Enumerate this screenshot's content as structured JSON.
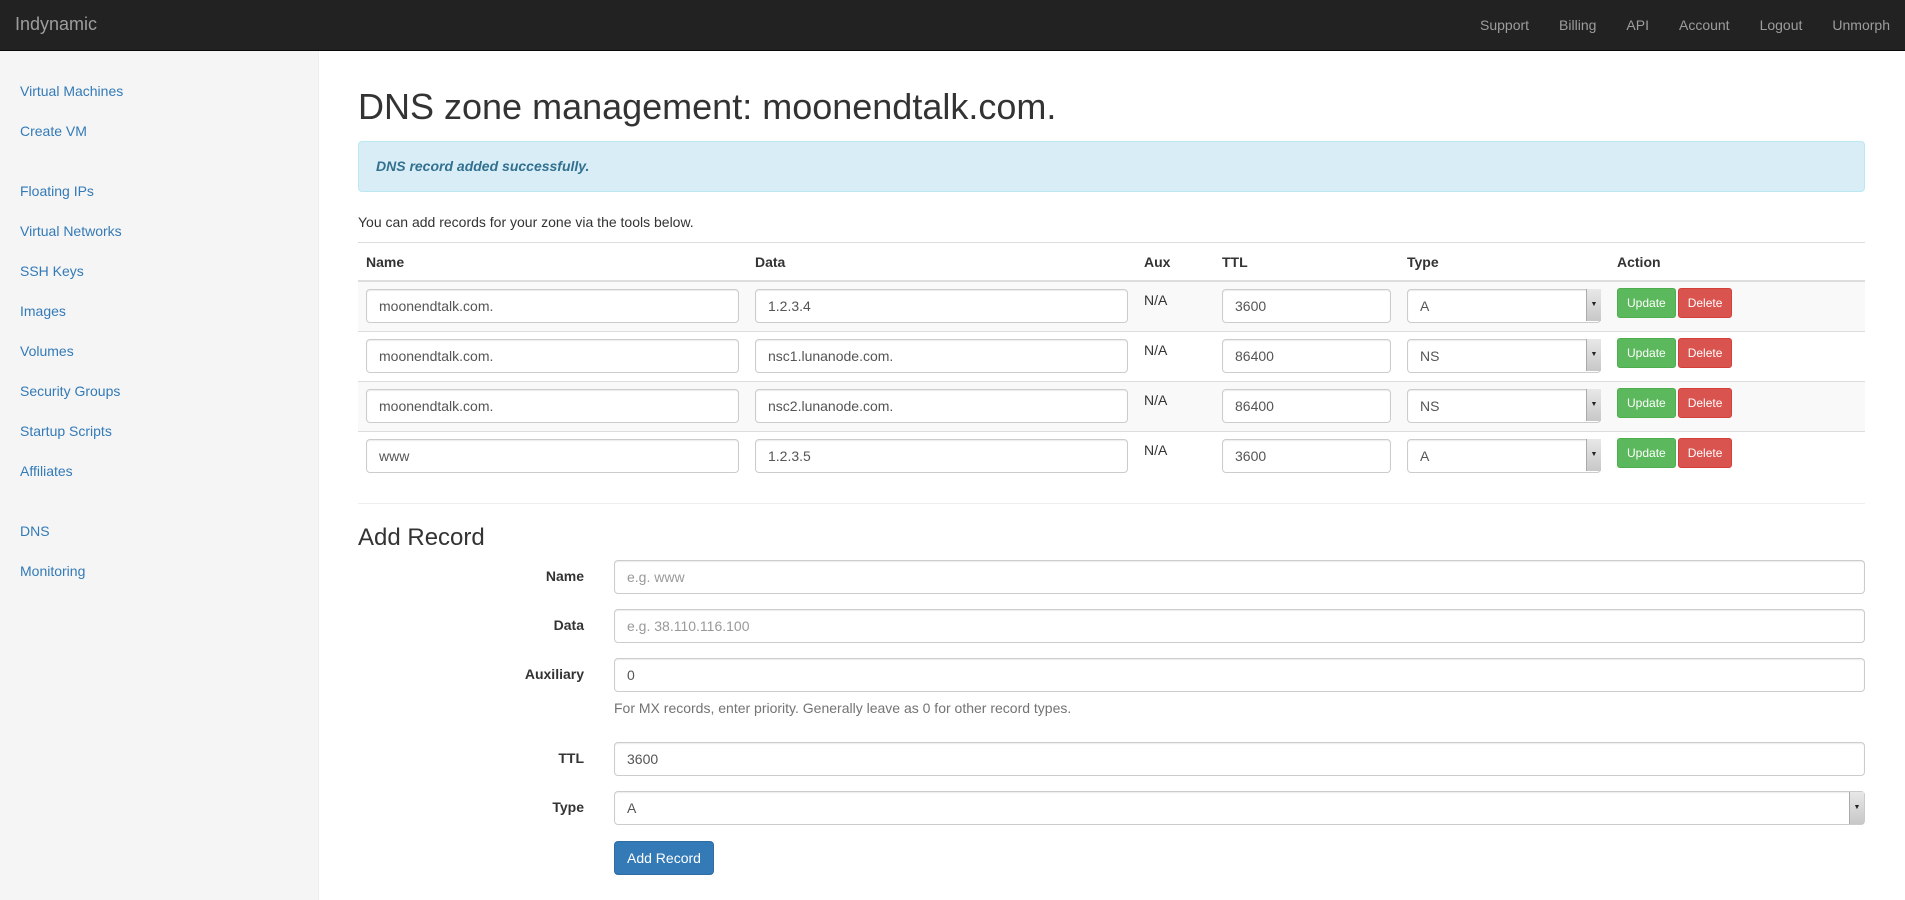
{
  "nav": {
    "brand": "Indynamic",
    "links": [
      "Support",
      "Billing",
      "API",
      "Account",
      "Logout",
      "Unmorph"
    ]
  },
  "sidebar": {
    "items": [
      "Virtual Machines",
      "Create VM",
      "Floating IPs",
      "Virtual Networks",
      "SSH Keys",
      "Images",
      "Volumes",
      "Security Groups",
      "Startup Scripts",
      "Affiliates",
      "DNS",
      "Monitoring"
    ]
  },
  "page": {
    "title": "DNS zone management: moonendtalk.com.",
    "alert": "DNS record added successfully.",
    "intro": "You can add records for your zone via the tools below."
  },
  "table": {
    "headers": [
      "Name",
      "Data",
      "Aux",
      "TTL",
      "Type",
      "Action"
    ],
    "rows": [
      {
        "name": "moonendtalk.com.",
        "data": "1.2.3.4",
        "aux": "N/A",
        "ttl": "3600",
        "type": "A"
      },
      {
        "name": "moonendtalk.com.",
        "data": "nsc1.lunanode.com.",
        "aux": "N/A",
        "ttl": "86400",
        "type": "NS"
      },
      {
        "name": "moonendtalk.com.",
        "data": "nsc2.lunanode.com.",
        "aux": "N/A",
        "ttl": "86400",
        "type": "NS"
      },
      {
        "name": "www",
        "data": "1.2.3.5",
        "aux": "N/A",
        "ttl": "3600",
        "type": "A"
      }
    ],
    "update_label": "Update",
    "delete_label": "Delete"
  },
  "add_record": {
    "heading": "Add Record",
    "name_label": "Name",
    "name_placeholder": "e.g. www",
    "data_label": "Data",
    "data_placeholder": "e.g. 38.110.116.100",
    "aux_label": "Auxiliary",
    "aux_value": "0",
    "aux_help": "For MX records, enter priority. Generally leave as 0 for other record types.",
    "ttl_label": "TTL",
    "ttl_value": "3600",
    "type_label": "Type",
    "type_value": "A",
    "submit_label": "Add Record"
  },
  "colors": {
    "navbar": "#222222",
    "link": "#337ab7",
    "success": "#5cb85c",
    "danger": "#d9534f",
    "alert_bg": "#d9edf7"
  }
}
